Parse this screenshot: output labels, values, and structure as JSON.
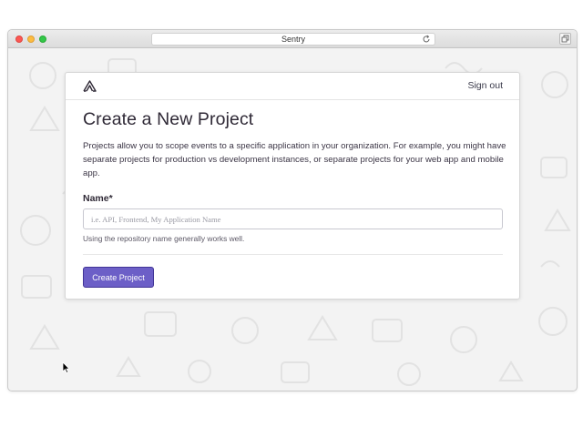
{
  "browser": {
    "url_title": "Sentry"
  },
  "header": {
    "sign_out_label": "Sign out"
  },
  "page": {
    "title": "Create a New Project",
    "description": "Projects allow you to scope events to a specific application in your organization. For example, you might have separate projects for production vs development instances, or separate projects for your web app and mobile app."
  },
  "form": {
    "name_label": "Name*",
    "name_value": "",
    "name_placeholder": "i.e. API, Frontend, My Application Name",
    "help_text": "Using the repository name generally works well.",
    "submit_label": "Create Project"
  },
  "icons": {
    "logo": "sentry-logo-icon",
    "reload": "reload-icon",
    "tabs": "tabs-icon",
    "cursor": "mouse-cursor-icon"
  },
  "colors": {
    "primary_button": "#6c5fc7",
    "primary_button_border": "#413496",
    "page_background": "#f3f3f3",
    "text_dark": "#2f2936"
  }
}
